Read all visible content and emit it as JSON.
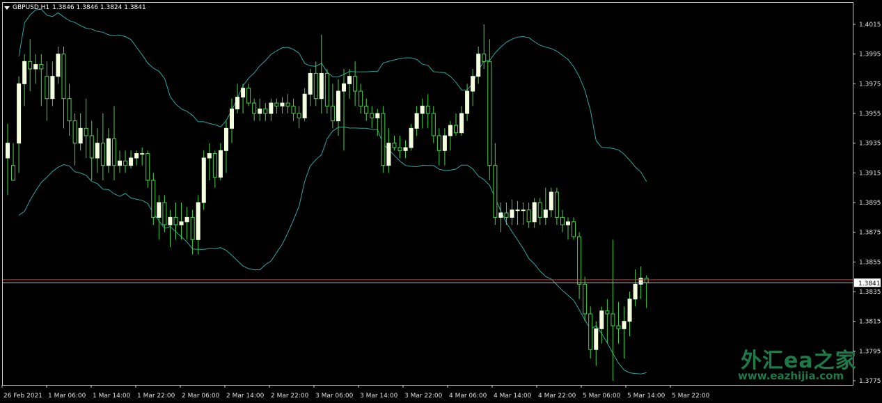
{
  "header": {
    "symbol": "GBPUSD,H1",
    "ohlc": "1.3846 1.3846 1.3824 1.3841"
  },
  "colors": {
    "background": "#000000",
    "bull_body": "#f4ffe0",
    "wick": "#48d448",
    "bands": "#2aa8a0",
    "ask_line": "#ff2020",
    "bid_line": "#c0c0c0",
    "price_tag_bg": "#ffffff",
    "watermark": "#1f7a4a"
  },
  "icons": {
    "menu": "triangle-down-icon"
  },
  "watermark": {
    "title": "外汇ea之家",
    "url": "www.eazhijia.com"
  },
  "chart_data": {
    "type": "candlestick",
    "symbol": "GBPUSD",
    "timeframe": "H1",
    "ylim": [
      1.3768,
      1.4025
    ],
    "y_ticks": [
      "1.4015",
      "1.3995",
      "1.3975",
      "1.3955",
      "1.3935",
      "1.3915",
      "1.3895",
      "1.3875",
      "1.3855",
      "1.3835",
      "1.3815",
      "1.3795",
      "1.3775"
    ],
    "x_ticks": [
      "26 Feb 2021",
      "1 Mar 06:00",
      "1 Mar 14:00",
      "1 Mar 22:00",
      "2 Mar 06:00",
      "2 Mar 14:00",
      "2 Mar 22:00",
      "3 Mar 06:00",
      "3 Mar 14:00",
      "3 Mar 22:00",
      "4 Mar 06:00",
      "4 Mar 14:00",
      "4 Mar 22:00",
      "5 Mar 06:00",
      "5 Mar 14:00",
      "5 Mar 22:00"
    ],
    "current_price": "1.3841",
    "ask_price": 1.3843,
    "candles": [
      [
        1.3925,
        1.3948,
        1.39,
        1.3935
      ],
      [
        1.392,
        1.3935,
        1.391,
        1.391
      ],
      [
        1.3935,
        1.398,
        1.3915,
        1.3975
      ],
      [
        1.3975,
        1.3995,
        1.396,
        1.399
      ],
      [
        1.399,
        1.4005,
        1.397,
        1.3985
      ],
      [
        1.3985,
        1.3995,
        1.3975,
        1.3988
      ],
      [
        1.3988,
        1.3995,
        1.396,
        1.3985
      ],
      [
        1.398,
        1.399,
        1.395,
        1.3965
      ],
      [
        1.3965,
        1.399,
        1.396,
        1.398
      ],
      [
        1.398,
        1.4,
        1.3975,
        1.3995
      ],
      [
        1.3995,
        1.4,
        1.3945,
        1.3965
      ],
      [
        1.3965,
        1.3975,
        1.394,
        1.395
      ],
      [
        1.395,
        1.3955,
        1.392,
        1.3935
      ],
      [
        1.3935,
        1.3955,
        1.393,
        1.3945
      ],
      [
        1.3945,
        1.3965,
        1.3925,
        1.394
      ],
      [
        1.394,
        1.395,
        1.391,
        1.3925
      ],
      [
        1.3925,
        1.3945,
        1.3915,
        1.3935
      ],
      [
        1.3935,
        1.3955,
        1.391,
        1.392
      ],
      [
        1.392,
        1.3945,
        1.3915,
        1.3938
      ],
      [
        1.3938,
        1.396,
        1.391,
        1.392
      ],
      [
        1.392,
        1.393,
        1.3915,
        1.3923
      ],
      [
        1.3923,
        1.393,
        1.3915,
        1.392
      ],
      [
        1.392,
        1.393,
        1.3918,
        1.3925
      ],
      [
        1.3925,
        1.393,
        1.392,
        1.3928
      ],
      [
        1.3928,
        1.3932,
        1.392,
        1.3928
      ],
      [
        1.3928,
        1.393,
        1.3905,
        1.391
      ],
      [
        1.391,
        1.3915,
        1.388,
        1.3885
      ],
      [
        1.3885,
        1.39,
        1.387,
        1.3895
      ],
      [
        1.3895,
        1.39,
        1.3875,
        1.388
      ],
      [
        1.388,
        1.389,
        1.3865,
        1.3885
      ],
      [
        1.3885,
        1.3895,
        1.387,
        1.388
      ],
      [
        1.388,
        1.3895,
        1.387,
        1.3882
      ],
      [
        1.3882,
        1.3892,
        1.387,
        1.3885
      ],
      [
        1.3885,
        1.389,
        1.386,
        1.387
      ],
      [
        1.387,
        1.39,
        1.386,
        1.3895
      ],
      [
        1.3895,
        1.393,
        1.389,
        1.3925
      ],
      [
        1.3925,
        1.3935,
        1.391,
        1.3928
      ],
      [
        1.3928,
        1.393,
        1.3905,
        1.3912
      ],
      [
        1.3912,
        1.3935,
        1.391,
        1.393
      ],
      [
        1.393,
        1.395,
        1.3915,
        1.3945
      ],
      [
        1.3945,
        1.3965,
        1.3935,
        1.3958
      ],
      [
        1.3958,
        1.3975,
        1.3955,
        1.3966
      ],
      [
        1.3966,
        1.3975,
        1.3955,
        1.3972
      ],
      [
        1.3972,
        1.3975,
        1.396,
        1.3962
      ],
      [
        1.3962,
        1.3965,
        1.395,
        1.3955
      ],
      [
        1.3955,
        1.3965,
        1.395,
        1.3958
      ],
      [
        1.3958,
        1.3962,
        1.395,
        1.3955
      ],
      [
        1.3955,
        1.3965,
        1.395,
        1.3962
      ],
      [
        1.3962,
        1.3965,
        1.3955,
        1.396
      ],
      [
        1.396,
        1.3966,
        1.3955,
        1.3962
      ],
      [
        1.3962,
        1.3968,
        1.3955,
        1.396
      ],
      [
        1.396,
        1.3965,
        1.395,
        1.3955
      ],
      [
        1.3955,
        1.396,
        1.3945,
        1.3952
      ],
      [
        1.3952,
        1.3972,
        1.395,
        1.3968
      ],
      [
        1.3968,
        1.3985,
        1.396,
        1.3982
      ],
      [
        1.3982,
        1.399,
        1.396,
        1.3965
      ],
      [
        1.3965,
        1.4008,
        1.3955,
        1.3982
      ],
      [
        1.3982,
        1.3985,
        1.3955,
        1.396
      ],
      [
        1.396,
        1.3975,
        1.3945,
        1.395
      ],
      [
        1.395,
        1.3978,
        1.394,
        1.397
      ],
      [
        1.397,
        1.3985,
        1.393,
        1.3975
      ],
      [
        1.3975,
        1.3985,
        1.3965,
        1.398
      ],
      [
        1.398,
        1.399,
        1.396,
        1.397
      ],
      [
        1.397,
        1.3975,
        1.3955,
        1.396
      ],
      [
        1.396,
        1.3965,
        1.395,
        1.3955
      ],
      [
        1.3955,
        1.396,
        1.3945,
        1.3952
      ],
      [
        1.3952,
        1.3958,
        1.394,
        1.3955
      ],
      [
        1.3955,
        1.396,
        1.3915,
        1.392
      ],
      [
        1.392,
        1.3945,
        1.3915,
        1.3935
      ],
      [
        1.3935,
        1.394,
        1.393,
        1.3932
      ],
      [
        1.3932,
        1.394,
        1.3925,
        1.393
      ],
      [
        1.393,
        1.3937,
        1.3925,
        1.3932
      ],
      [
        1.3932,
        1.3948,
        1.393,
        1.3945
      ],
      [
        1.3945,
        1.396,
        1.394,
        1.3955
      ],
      [
        1.3955,
        1.3965,
        1.3945,
        1.396
      ],
      [
        1.396,
        1.3968,
        1.3945,
        1.3955
      ],
      [
        1.3955,
        1.396,
        1.3935,
        1.394
      ],
      [
        1.394,
        1.3945,
        1.392,
        1.393
      ],
      [
        1.393,
        1.3945,
        1.392,
        1.394
      ],
      [
        1.394,
        1.395,
        1.393,
        1.3947
      ],
      [
        1.3947,
        1.3955,
        1.394,
        1.3942
      ],
      [
        1.3942,
        1.396,
        1.394,
        1.3955
      ],
      [
        1.3955,
        1.3975,
        1.395,
        1.397
      ],
      [
        1.397,
        1.3985,
        1.396,
        1.398
      ],
      [
        1.398,
        1.4,
        1.3975,
        1.3995
      ],
      [
        1.3995,
        1.4015,
        1.3985,
        1.399
      ],
      [
        1.399,
        1.4005,
        1.391,
        1.392
      ],
      [
        1.392,
        1.3935,
        1.388,
        1.3885
      ],
      [
        1.3885,
        1.3895,
        1.3875,
        1.3888
      ],
      [
        1.3888,
        1.3895,
        1.388,
        1.3885
      ],
      [
        1.3885,
        1.3897,
        1.388,
        1.389
      ],
      [
        1.389,
        1.3896,
        1.388,
        1.389
      ],
      [
        1.389,
        1.3895,
        1.388,
        1.389
      ],
      [
        1.389,
        1.3895,
        1.3878,
        1.3882
      ],
      [
        1.3882,
        1.3898,
        1.3878,
        1.3895
      ],
      [
        1.3895,
        1.3898,
        1.388,
        1.3885
      ],
      [
        1.3885,
        1.3905,
        1.388,
        1.389
      ],
      [
        1.389,
        1.3905,
        1.3885,
        1.3902
      ],
      [
        1.3902,
        1.3905,
        1.388,
        1.3885
      ],
      [
        1.3885,
        1.389,
        1.3875,
        1.388
      ],
      [
        1.388,
        1.3885,
        1.387,
        1.3882
      ],
      [
        1.3882,
        1.3885,
        1.387,
        1.3872
      ],
      [
        1.3872,
        1.3875,
        1.383,
        1.384
      ],
      [
        1.384,
        1.3845,
        1.3815,
        1.382
      ],
      [
        1.382,
        1.3825,
        1.379,
        1.3796
      ],
      [
        1.3796,
        1.3815,
        1.3785,
        1.381
      ],
      [
        1.381,
        1.3825,
        1.38,
        1.3822
      ],
      [
        1.3822,
        1.383,
        1.38,
        1.382
      ],
      [
        1.382,
        1.387,
        1.3775,
        1.3812
      ],
      [
        1.3812,
        1.3828,
        1.38,
        1.381
      ],
      [
        1.381,
        1.3825,
        1.379,
        1.3815
      ],
      [
        1.3815,
        1.3835,
        1.3805,
        1.383
      ],
      [
        1.383,
        1.385,
        1.3825,
        1.384
      ],
      [
        1.384,
        1.3852,
        1.383,
        1.3844
      ],
      [
        1.3844,
        1.3846,
        1.3824,
        1.3841
      ]
    ]
  }
}
